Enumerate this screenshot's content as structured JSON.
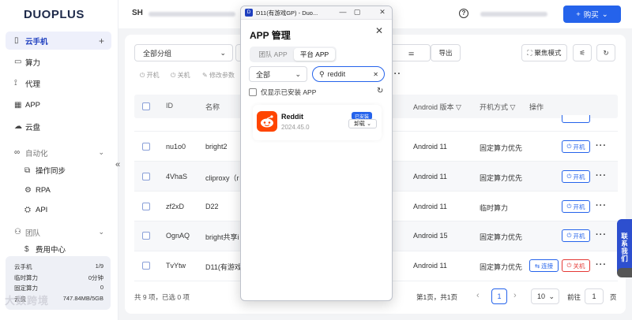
{
  "brand": {
    "logo_text": "DUOPLUS"
  },
  "sidebar": {
    "items": [
      {
        "label": "云手机",
        "icon": "phone-icon"
      },
      {
        "label": "算力",
        "icon": "monitor-icon"
      },
      {
        "label": "代理",
        "icon": "proxy-icon"
      },
      {
        "label": "APP",
        "icon": "grid-icon"
      },
      {
        "label": "云盘",
        "icon": "cloud-icon"
      },
      {
        "label": "自动化",
        "icon": "automation-icon"
      },
      {
        "label": "操作同步",
        "icon": "sync-icon"
      },
      {
        "label": "RPA",
        "icon": "rpa-icon"
      },
      {
        "label": "API",
        "icon": "api-icon"
      },
      {
        "label": "团队",
        "icon": "team-icon"
      },
      {
        "label": "费用中心",
        "icon": "dollar-icon"
      }
    ],
    "plus": "+",
    "chevron": "⌄",
    "collapse": "«"
  },
  "quota": {
    "rows": [
      {
        "label": "云手机",
        "value": "1/9"
      },
      {
        "label": "临时算力",
        "value": "0分钟"
      },
      {
        "label": "固定算力",
        "value": "0"
      },
      {
        "label": "云盘",
        "value": "747.84MB/5GB"
      }
    ]
  },
  "watermark": "大数跨境",
  "topbar": {
    "workspace_prefix": "SH",
    "help": "?",
    "buy_label": "购买",
    "buy_plus": "+",
    "buy_caret": "⌄"
  },
  "toolbar": {
    "group_select": "全部分组",
    "group_caret": "⌄",
    "export": "导出",
    "focus_mode": "聚焦模式",
    "actions": [
      {
        "label": "开机",
        "icon": "power-icon"
      },
      {
        "label": "关机",
        "icon": "power-off-icon"
      },
      {
        "label": "修改参数",
        "icon": "edit-icon"
      }
    ]
  },
  "table": {
    "columns": {
      "id": "ID",
      "name": "名称",
      "android": "Android 版本",
      "boot": "开机方式",
      "op": "操作"
    },
    "rows": [
      {
        "id": "nu1o0",
        "name": "bright2",
        "android": "Android 11",
        "boot": "固定算力优先",
        "btn": "开机",
        "connect": ""
      },
      {
        "id": "4VhaS",
        "name": "cliproxy（r",
        "android": "Android 11",
        "boot": "固定算力优先",
        "btn": "开机",
        "connect": ""
      },
      {
        "id": "zf2xD",
        "name": "D22",
        "android": "Android 11",
        "boot": "临时算力",
        "btn": "开机",
        "connect": ""
      },
      {
        "id": "OgnAQ",
        "name": "bright共享i",
        "android": "Android 15",
        "boot": "固定算力优先",
        "btn": "开机",
        "connect": ""
      },
      {
        "id": "TvYtw",
        "name": "D11(有游戏(",
        "android": "Android 11",
        "boot": "固定算力优先",
        "btn": "关机",
        "connect": "连接"
      }
    ],
    "more": "···"
  },
  "footer": {
    "summary": "共 9 项，已选 0 项",
    "page_info": "第1页，共1页",
    "prev": "‹",
    "current": "1",
    "next": "›",
    "page_size": "10",
    "goto_label": "前往",
    "goto_value": "1",
    "goto_suffix": "页"
  },
  "feedback": "联系我们",
  "modal": {
    "window_title": "D11(有游戏GP) - Duo...",
    "win_min": "—",
    "win_max": "▢",
    "win_close": "✕",
    "title": "APP 管理",
    "close": "✕",
    "tabs": [
      {
        "label": "团队 APP",
        "active": false
      },
      {
        "label": "平台 APP",
        "active": true
      }
    ],
    "filter": "全部",
    "filter_caret": "⌄",
    "search_value": "reddit",
    "search_clear": "✕",
    "only_installed": "仅显示已安装 APP",
    "app": {
      "name": "Reddit",
      "version": "2024.45.0",
      "badge": "已安装",
      "action": "卸载",
      "action_caret": "⌄"
    }
  },
  "colors": {
    "primary": "#2563eb",
    "reddit": "#ff4500",
    "danger": "#e53935"
  }
}
